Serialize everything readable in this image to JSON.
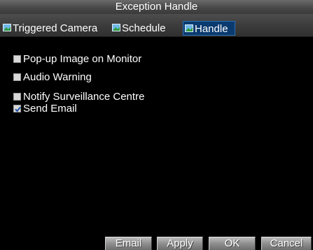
{
  "window": {
    "title": "Exception Handle"
  },
  "tabs": [
    {
      "label": "Triggered Camera",
      "icon": "camera-tab-icon",
      "active": false
    },
    {
      "label": "Schedule",
      "icon": "schedule-tab-icon",
      "active": false
    },
    {
      "label": "Handle",
      "icon": "handle-tab-icon",
      "active": true
    }
  ],
  "options": [
    {
      "label": "Pop-up Image on Monitor",
      "checked": false
    },
    {
      "label": "Audio Warning",
      "checked": false
    },
    {
      "label": "Notify Surveillance Centre",
      "checked": false
    },
    {
      "label": "Send Email",
      "checked": true
    }
  ],
  "buttons": {
    "email": "Email",
    "apply": "Apply",
    "ok": "OK",
    "cancel": "Cancel"
  },
  "colors": {
    "background": "#000000",
    "active_tab": "#0a3a6e",
    "text": "#ffffff"
  }
}
